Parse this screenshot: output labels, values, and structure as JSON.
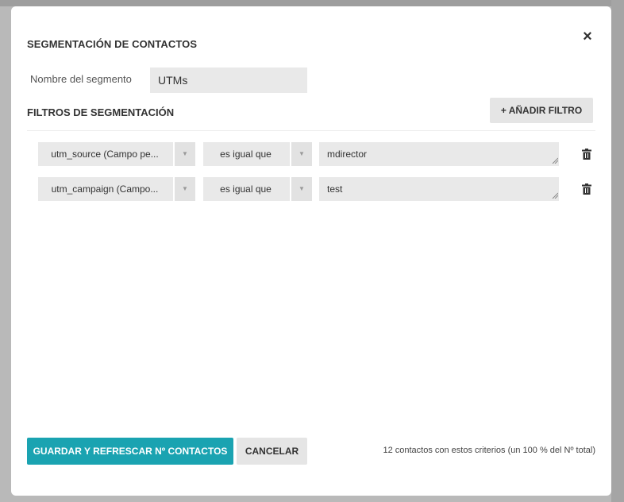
{
  "dialog": {
    "title": "SEGMENTACIÓN DE CONTACTOS",
    "close_icon": "×"
  },
  "segment": {
    "name_label": "Nombre del segmento",
    "name_value": "UTMs"
  },
  "filters": {
    "title": "FILTROS DE SEGMENTACIÓN",
    "add_label": "+ AÑADIR FILTRO",
    "rows": [
      {
        "field": "utm_source (Campo pe...",
        "operator": "es igual que",
        "value": "mdirector"
      },
      {
        "field": "utm_campaign (Campo...",
        "operator": "es igual que",
        "value": "test"
      }
    ]
  },
  "icons": {
    "dropdown_arrow": "▼",
    "delete": "trash-icon",
    "close": "close-icon"
  },
  "footer": {
    "save_label": "GUARDAR Y REFRESCAR Nº CONTACTOS",
    "cancel_label": "CANCELAR",
    "status": "12 contactos con estos criterios (un 100 % del Nº total)"
  },
  "colors": {
    "primary": "#1aa3b1",
    "field_bg": "#e9e9e9"
  }
}
